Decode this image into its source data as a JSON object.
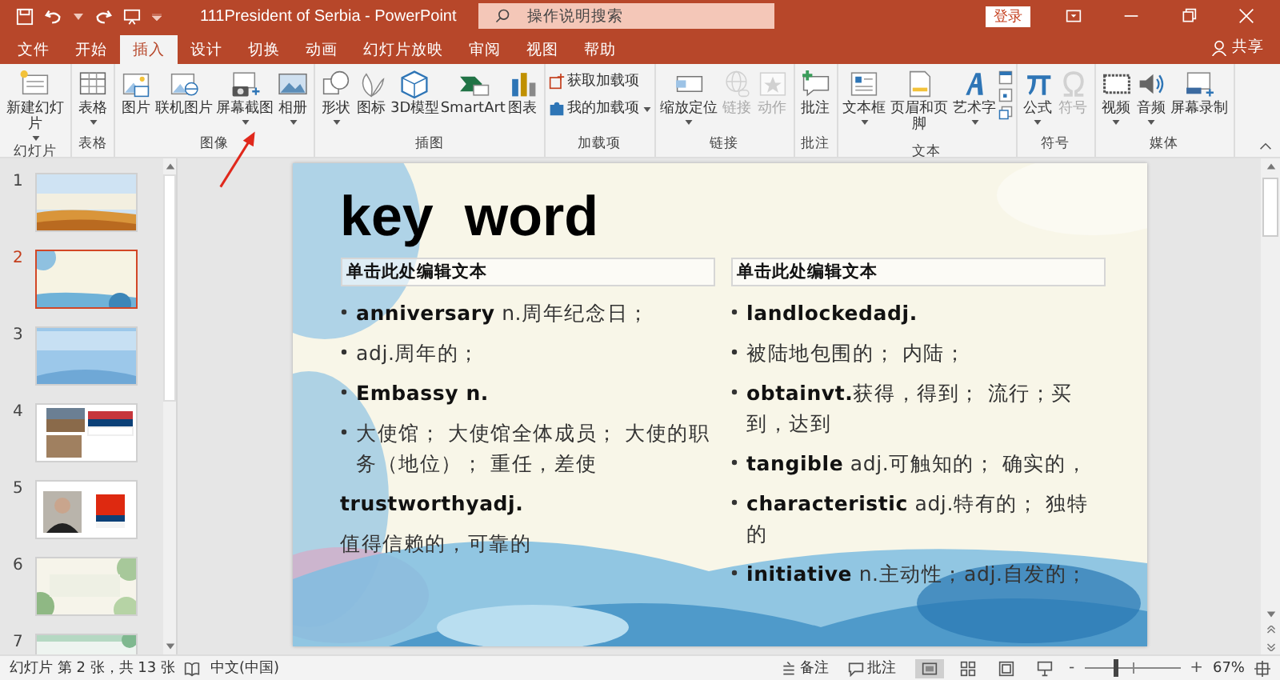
{
  "window": {
    "title": "111President of Serbia  -  PowerPoint",
    "search_placeholder": "操作说明搜索",
    "login": "登录",
    "share": "共享"
  },
  "tabs": [
    {
      "label": "文件",
      "selected": false
    },
    {
      "label": "开始",
      "selected": false
    },
    {
      "label": "插入",
      "selected": true
    },
    {
      "label": "设计",
      "selected": false
    },
    {
      "label": "切换",
      "selected": false
    },
    {
      "label": "动画",
      "selected": false
    },
    {
      "label": "幻灯片放映",
      "selected": false
    },
    {
      "label": "审阅",
      "selected": false
    },
    {
      "label": "视图",
      "selected": false
    },
    {
      "label": "帮助",
      "selected": false
    }
  ],
  "ribbon": {
    "groups": [
      {
        "label": "幻灯片",
        "items": [
          {
            "kind": "large",
            "label": "新建幻灯片",
            "dropdown": true,
            "disabled": false
          }
        ]
      },
      {
        "label": "表格",
        "items": [
          {
            "kind": "large",
            "label": "表格",
            "dropdown": true,
            "disabled": false
          }
        ]
      },
      {
        "label": "图像",
        "items": [
          {
            "kind": "large",
            "label": "图片",
            "dropdown": false,
            "disabled": false
          },
          {
            "kind": "large",
            "label": "联机图片",
            "dropdown": false,
            "disabled": false
          },
          {
            "kind": "large",
            "label": "屏幕截图",
            "dropdown": true,
            "disabled": false
          },
          {
            "kind": "large",
            "label": "相册",
            "dropdown": true,
            "disabled": false
          }
        ]
      },
      {
        "label": "插图",
        "items": [
          {
            "kind": "large",
            "label": "形状",
            "dropdown": true,
            "disabled": false
          },
          {
            "kind": "large",
            "label": "图标",
            "dropdown": false,
            "disabled": false
          },
          {
            "kind": "large",
            "label": "3D模型",
            "dropdown": false,
            "disabled": false
          },
          {
            "kind": "large",
            "label": "SmartArt",
            "dropdown": false,
            "disabled": false
          },
          {
            "kind": "large",
            "label": "图表",
            "dropdown": false,
            "disabled": false
          }
        ]
      },
      {
        "label": "加载项",
        "items": [
          {
            "kind": "small",
            "label": "获取加载项",
            "dropdown": false,
            "disabled": false
          },
          {
            "kind": "small",
            "label": "我的加载项",
            "dropdown": true,
            "disabled": false
          }
        ]
      },
      {
        "label": "链接",
        "items": [
          {
            "kind": "large",
            "label": "缩放定位",
            "dropdown": true,
            "disabled": false
          },
          {
            "kind": "large",
            "label": "链接",
            "dropdown": false,
            "disabled": true
          },
          {
            "kind": "large",
            "label": "动作",
            "dropdown": false,
            "disabled": true
          }
        ]
      },
      {
        "label": "批注",
        "items": [
          {
            "kind": "large",
            "label": "批注",
            "dropdown": false,
            "disabled": false
          }
        ]
      },
      {
        "label": "文本",
        "items": [
          {
            "kind": "large",
            "label": "文本框",
            "dropdown": true,
            "disabled": false
          },
          {
            "kind": "large",
            "label": "页眉和页脚",
            "dropdown": false,
            "disabled": false
          },
          {
            "kind": "large",
            "label": "艺术字",
            "dropdown": true,
            "disabled": false
          },
          {
            "kind": "icons"
          }
        ]
      },
      {
        "label": "符号",
        "items": [
          {
            "kind": "large",
            "label": "公式",
            "dropdown": true,
            "disabled": false
          },
          {
            "kind": "large",
            "label": "符号",
            "dropdown": false,
            "disabled": true
          }
        ]
      },
      {
        "label": "媒体",
        "items": [
          {
            "kind": "large",
            "label": "视频",
            "dropdown": true,
            "disabled": false
          },
          {
            "kind": "large",
            "label": "音频",
            "dropdown": true,
            "disabled": false
          },
          {
            "kind": "large",
            "label": "屏幕录制",
            "dropdown": false,
            "disabled": false
          }
        ]
      }
    ]
  },
  "slides": [
    {
      "number": "1",
      "selected": false
    },
    {
      "number": "2",
      "selected": true
    },
    {
      "number": "3",
      "selected": false
    },
    {
      "number": "4",
      "selected": false
    },
    {
      "number": "5",
      "selected": false
    },
    {
      "number": "6",
      "selected": false
    },
    {
      "number": "7",
      "selected": false
    }
  ],
  "slide": {
    "title": "key  word",
    "columns": [
      {
        "heading": "单击此处编辑文本",
        "items": [
          {
            "text": "**anniversary**  n.周年纪念日；",
            "bullet": true
          },
          {
            "text": "adj.周年的；",
            "bullet": true
          },
          {
            "text": "**Embassy n.**",
            "bullet": true
          },
          {
            "text": "大使馆； 大使馆全体成员； 大使的职务（地位）； 重任，差使",
            "bullet": true
          },
          {
            "text": "**trustworthyadj.**",
            "bullet": false
          },
          {
            "text": "值得信赖的，可靠的",
            "bullet": false
          }
        ]
      },
      {
        "heading": "单击此处编辑文本",
        "items": [
          {
            "text": "**landlockedadj.**",
            "bullet": true
          },
          {
            "text": "被陆地包围的； 内陆；",
            "bullet": true
          },
          {
            "text": "**obtainvt.**获得，得到； 流行；买到，达到",
            "bullet": true
          },
          {
            "text": "**tangible** adj.可触知的； 确实的，",
            "bullet": true
          },
          {
            "text": "**characteristic**  adj.特有的； 独特的",
            "bullet": true
          },
          {
            "text": "**initiative**  n.主动性；adj.自发的；",
            "bullet": true
          }
        ]
      }
    ]
  },
  "status_bar": {
    "slide_info": "幻灯片 第 2 张，共 13 张",
    "language": "中文(中国)",
    "notes": "备注",
    "comments": "批注",
    "views": [
      {
        "selected": true
      },
      {
        "selected": false
      },
      {
        "selected": false
      },
      {
        "selected": false
      }
    ],
    "zoom_out": "-",
    "zoom_in": "+",
    "zoom": {
      "level": 0.32
    },
    "zoom_value": "67%"
  }
}
